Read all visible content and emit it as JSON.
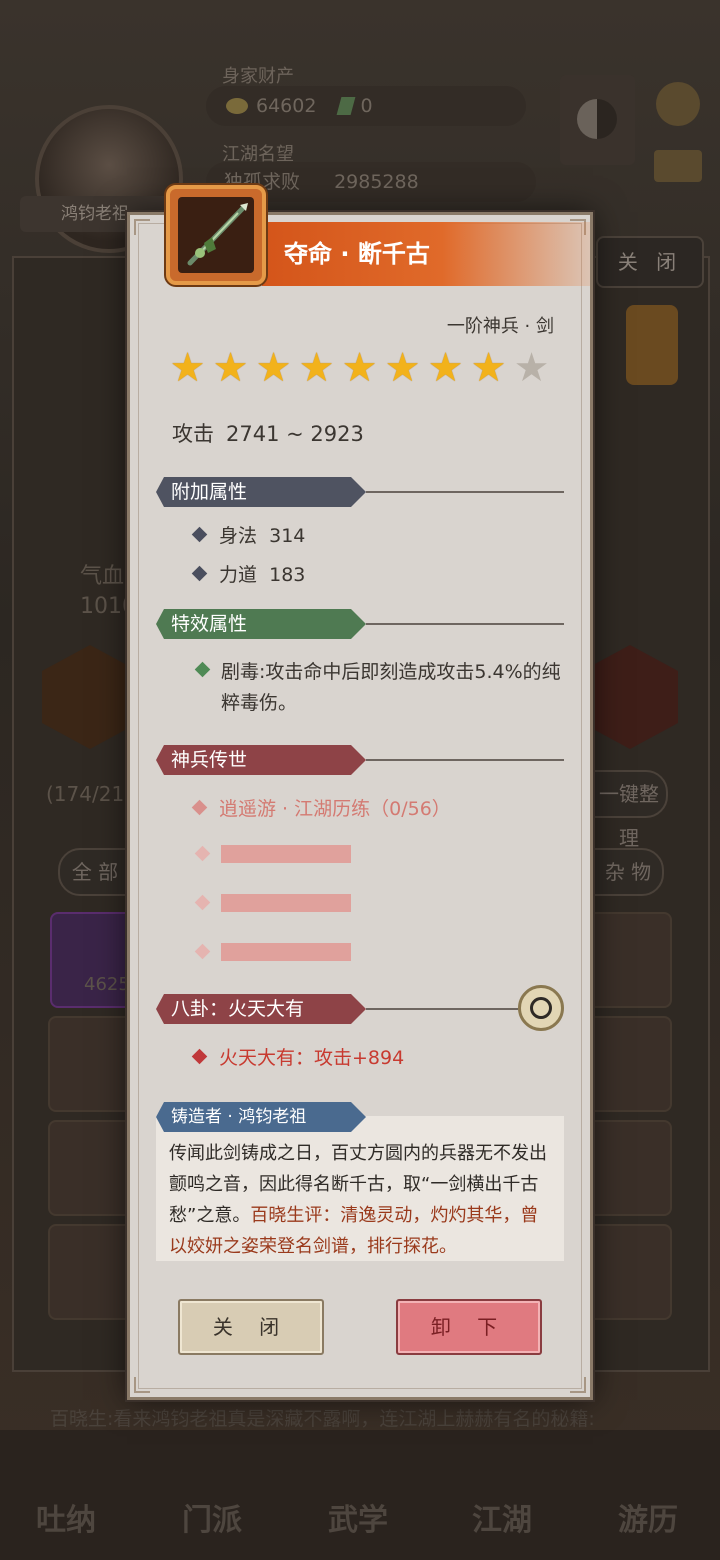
{
  "background": {
    "player_name": "鸿钧老祖",
    "wealth_label": "身家财产",
    "gold": "64602",
    "jade": "0",
    "fame_label": "江湖名望",
    "fame_title": "独孤求败",
    "fame_value": "2985288",
    "close_label": "关 闭",
    "left_stat_label": "气血",
    "left_stat_value": "1010",
    "bag_count": "(174/216",
    "sort_label": "一键整理",
    "tab_all": "全 部",
    "tab_misc": "杂 物",
    "slot_count": "4625",
    "marquee": "百晓生:看来鸿钧老祖真是深藏不露啊，连江湖上赫赫有名的秘籍:",
    "nav": [
      "吐纳",
      "门派",
      "武学",
      "江湖",
      "游历"
    ]
  },
  "item": {
    "name": "夺命 · 断千古",
    "grade": "一阶神兵 · 剑",
    "stars_total": 9,
    "stars_lit": 8,
    "attack_label": "攻击",
    "attack_value": "2741 ~ 2923",
    "colors": {
      "title": "#d4551a",
      "star": "#f2b21b",
      "legend_text": "#d47a72",
      "bagua_text": "#c83a30"
    }
  },
  "sections": {
    "extra": {
      "title": "附加属性",
      "rows": [
        {
          "name": "身法",
          "value": "314"
        },
        {
          "name": "力道",
          "value": "183"
        }
      ]
    },
    "special": {
      "title": "特效属性",
      "text": "剧毒:攻击命中后即刻造成攻击5.4%的纯粹毒伤。"
    },
    "legend": {
      "title": "神兵传世",
      "first": "逍遥游 · 江湖历练（0/56）",
      "locked_count": 3
    },
    "bagua": {
      "title": "八卦：火天大有",
      "effect": "火天大有：攻击+894",
      "icon": "bagua-icon"
    },
    "forger": {
      "title": "铸造者 · 鸿钧老祖",
      "text": "传闻此剑铸成之日，百丈方圆内的兵器无不发出颤鸣之音，因此得名断千古，取“一剑横出千古愁”之意。",
      "comment": "百晓生评：清逸灵动，灼灼其华，曾以姣妍之姿荣登名剑谱，排行探花。"
    }
  },
  "buttons": {
    "close": "关 闭",
    "unequip": "卸 下"
  }
}
